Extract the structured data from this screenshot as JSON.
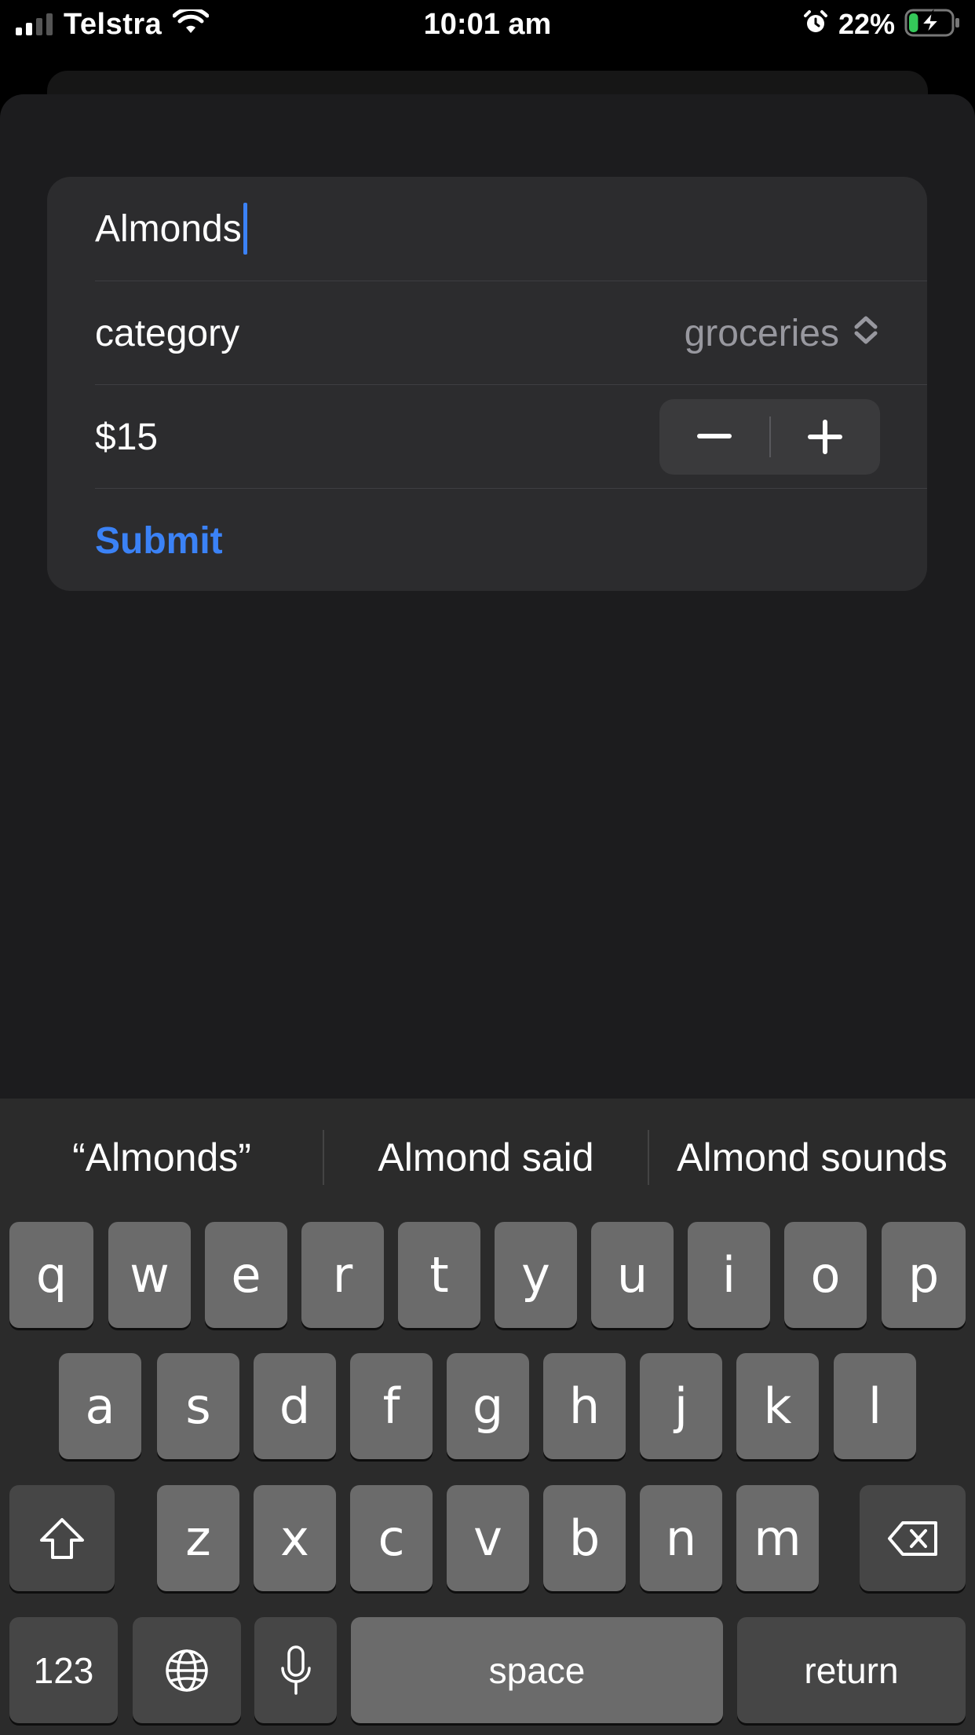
{
  "status_bar": {
    "carrier": "Telstra",
    "time": "10:01 am",
    "battery_percent": "22%",
    "battery_level": 0.22,
    "icons": [
      "signal-icon",
      "wifi-icon",
      "alarm-icon",
      "battery-charging-icon"
    ]
  },
  "form": {
    "name_value": "Almonds",
    "category_label": "category",
    "category_value": "groceries",
    "amount_value": "$15",
    "submit_label": "Submit"
  },
  "keyboard": {
    "suggestions": [
      "“Almonds”",
      "Almond said",
      "Almond sounds"
    ],
    "row1": [
      "q",
      "w",
      "e",
      "r",
      "t",
      "y",
      "u",
      "i",
      "o",
      "p"
    ],
    "row2": [
      "a",
      "s",
      "d",
      "f",
      "g",
      "h",
      "j",
      "k",
      "l"
    ],
    "row3": [
      "z",
      "x",
      "c",
      "v",
      "b",
      "n",
      "m"
    ],
    "numbers_label": "123",
    "space_label": "space",
    "return_label": "return"
  },
  "colors": {
    "accent": "#3b82f6",
    "background": "#1c1c1e",
    "card": "#2c2c2e"
  }
}
